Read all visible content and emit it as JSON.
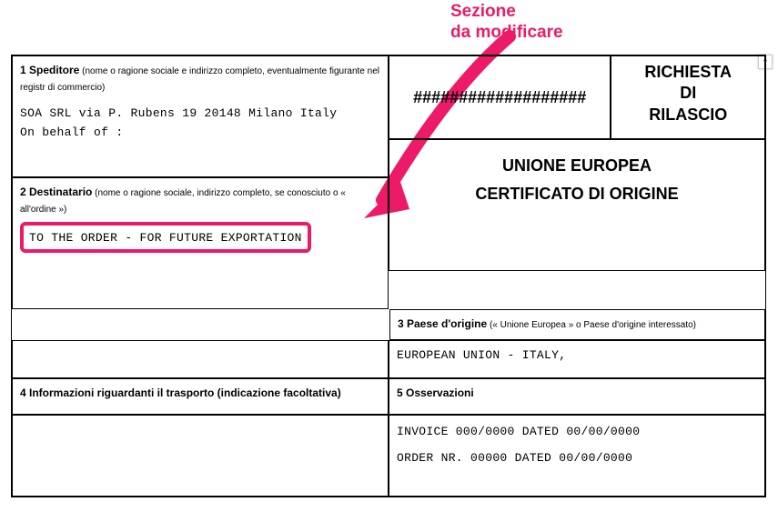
{
  "annotation": {
    "line1": "Sezione",
    "line2": "da modificare"
  },
  "box1": {
    "label_bold": "1 Speditore",
    "label_small": " (nome o ragione sociale e indirizzo completo, eventualmente figurante nel registr di commercio)",
    "value": "SOA SRL via P. Rubens 19 20148 Milano Italy On behalf of :"
  },
  "top_right": {
    "hash": "###################",
    "request_line1": "RICHIESTA",
    "request_line2": "DI",
    "request_line3": "RILASCIO"
  },
  "union": {
    "title1": "UNIONE EUROPEA",
    "title2": "CERTIFICATO DI ORIGINE"
  },
  "box2": {
    "label_bold": "2 Destinatario",
    "label_small": " (nome o ragione sociale, indirizzo completo, se conosciuto o « all'ordine »)",
    "value": "TO THE ORDER - FOR FUTURE EXPORTATION"
  },
  "box3": {
    "label_bold": "3 Paese d'origine",
    "label_small": " (« Unione Europea » o Paese d'origine interessato)",
    "value": "EUROPEAN UNION - ITALY,"
  },
  "box4": {
    "label_bold": "4 Informazioni riguardanti il trasporto (indicazione facoltativa)"
  },
  "box5": {
    "label_bold": "5 Osservazioni",
    "line1": "INVOICE 000/0000 DATED 00/00/0000",
    "line2": "ORDER NR. 00000 DATED 00/00/0000"
  }
}
